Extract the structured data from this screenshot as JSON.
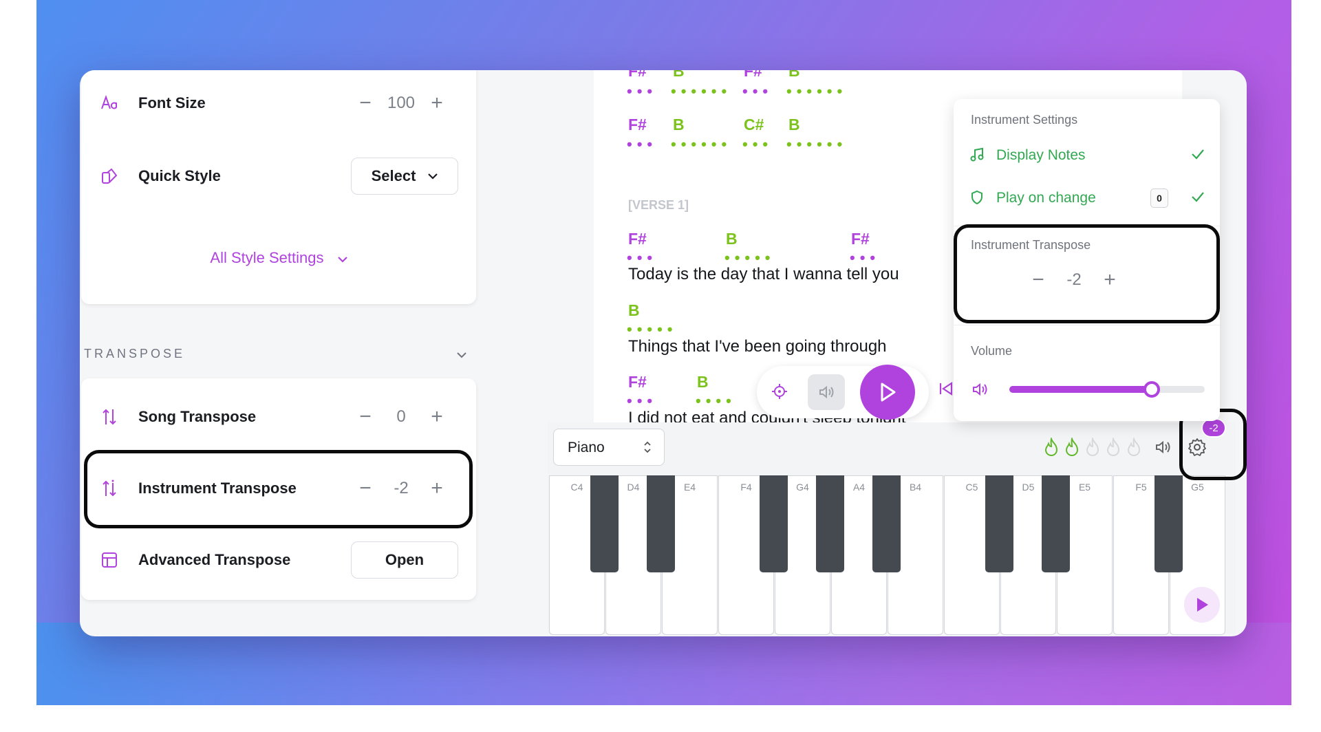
{
  "left": {
    "font_size": {
      "label": "Font Size",
      "value": "100"
    },
    "quick_style": {
      "label": "Quick Style",
      "button": "Select"
    },
    "all_style_settings": "All Style Settings",
    "transpose_header": "TRANSPOSE",
    "song_transpose": {
      "label": "Song Transpose",
      "value": "0"
    },
    "instrument_transpose": {
      "label": "Instrument Transpose",
      "value": "-2"
    },
    "advanced_transpose": {
      "label": "Advanced Transpose",
      "button": "Open"
    }
  },
  "sheet": {
    "top_row1": [
      "F#",
      "B",
      "F#",
      "B"
    ],
    "top_row2": [
      "F#",
      "B",
      "C#",
      "B"
    ],
    "section": "[VERSE 1]",
    "line1": {
      "chords": [
        "F#",
        "B",
        "F#"
      ],
      "lyric": "Today is the day that I wanna tell you"
    },
    "line2": {
      "chords": [
        "B"
      ],
      "lyric": "Things that I've been going through"
    },
    "line3": {
      "chords": [
        "F#",
        "B"
      ],
      "lyric": "I did not eat and couldn't sleep tonight"
    }
  },
  "popup": {
    "title": "Instrument Settings",
    "display_notes": "Display Notes",
    "play_on_change": "Play on change",
    "play_on_change_badge": "0",
    "transpose_title": "Instrument Transpose",
    "transpose_value": "-2",
    "volume_title": "Volume",
    "volume_level": 0.73
  },
  "keyboard": {
    "instrument": "Piano",
    "settings_badge": "-2",
    "white_keys": [
      "C4",
      "D4",
      "E4",
      "F4",
      "G4",
      "A4",
      "B4",
      "C5",
      "D5",
      "E5",
      "F5",
      "G5"
    ]
  },
  "colors": {
    "accent_purple": "#b043dd",
    "accent_green": "#7cc21d",
    "popup_green": "#32a852"
  }
}
